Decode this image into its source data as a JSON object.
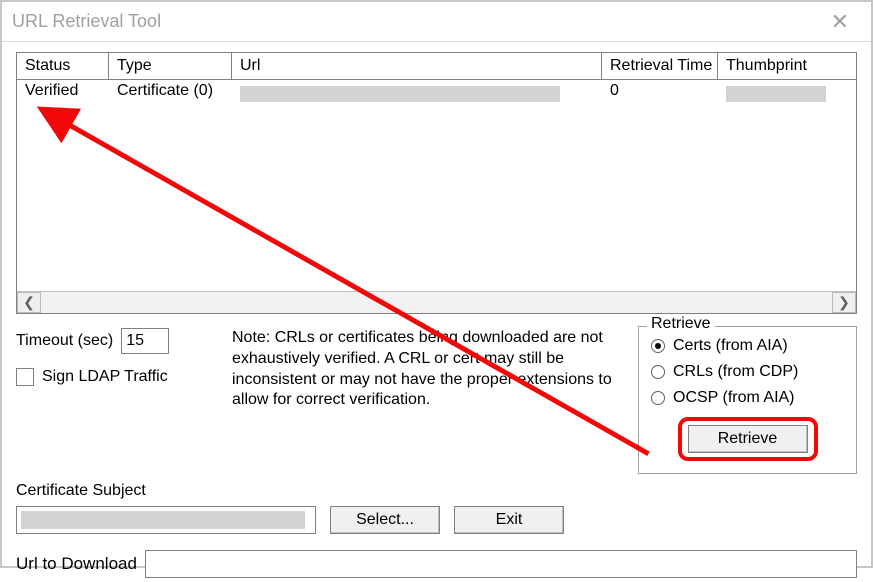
{
  "window": {
    "title": "URL Retrieval Tool"
  },
  "columns": {
    "status": "Status",
    "type": "Type",
    "url": "Url",
    "rt": "Retrieval Time",
    "thumb": "Thumbprint"
  },
  "row0": {
    "status": "Verified",
    "type": "Certificate (0)",
    "rt": "0"
  },
  "labels": {
    "timeout": "Timeout (sec)",
    "sign_ldap": "Sign LDAP Traffic",
    "note": "Note: CRLs or certificates being downloaded are not exhaustively verified.  A CRL or cert may still be inconsistent or may not have the proper extensions to allow for correct verification.",
    "cert_subject": "Certificate Subject",
    "select": "Select...",
    "exit": "Exit",
    "retrieve_group": "Retrieve",
    "opt_certs": "Certs (from AIA)",
    "opt_crls": "CRLs (from CDP)",
    "opt_ocsp": "OCSP (from AIA)",
    "retrieve_btn": "Retrieve",
    "url_download": "Url to Download"
  },
  "values": {
    "timeout": "15"
  },
  "annotation": {
    "color": "#f20808"
  }
}
